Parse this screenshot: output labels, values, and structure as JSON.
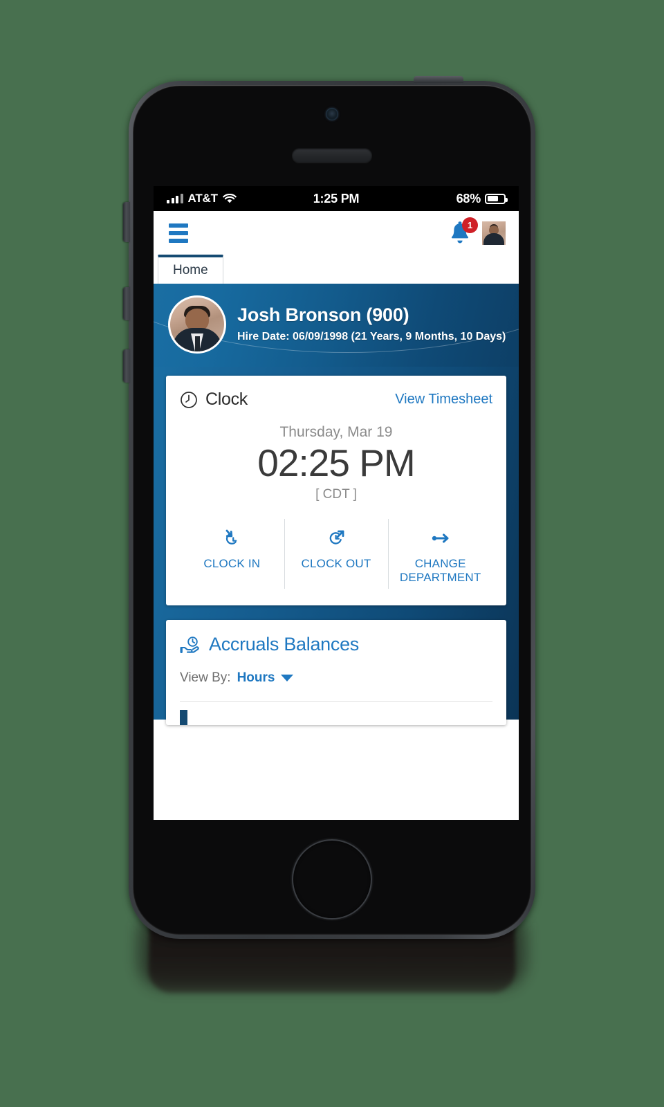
{
  "theme": {
    "page_background": "#48704f",
    "accent_blue": "#1f78c1",
    "dark_blue": "#154a72",
    "badge_red": "#cf2027"
  },
  "status_bar": {
    "carrier": "AT&T",
    "time": "1:25 PM",
    "battery_percent": "68%",
    "signal_icon": "cellular-signal-icon",
    "wifi_icon": "wifi-icon",
    "battery_icon": "battery-icon"
  },
  "header": {
    "menu_icon": "hamburger-menu-icon",
    "notification_icon": "bell-icon",
    "notification_count": "1",
    "avatar_icon": "user-avatar-thumbnail"
  },
  "tabs": [
    {
      "label": "Home",
      "active": true
    }
  ],
  "profile": {
    "avatar_icon": "employee-photo",
    "name": "Josh Bronson (900)",
    "hire_date": "Hire Date: 06/09/1998 (21 Years, 9 Months, 10 Days)"
  },
  "clock_card": {
    "icon": "clock-icon",
    "title": "Clock",
    "link_label": "View Timesheet",
    "date": "Thursday, Mar 19",
    "time": "02:25 PM",
    "timezone": "[ CDT ]",
    "actions": [
      {
        "label": "CLOCK IN",
        "icon": "clock-in-arrow-icon"
      },
      {
        "label": "CLOCK OUT",
        "icon": "clock-out-arrow-icon"
      },
      {
        "label": "CHANGE DEPARTMENT",
        "icon": "arrow-right-icon"
      }
    ]
  },
  "accruals_card": {
    "icon": "hand-holding-clock-icon",
    "title": "Accruals Balances",
    "view_by_label": "View By:",
    "view_by_value": "Hours",
    "caret_icon": "chevron-down-icon"
  }
}
